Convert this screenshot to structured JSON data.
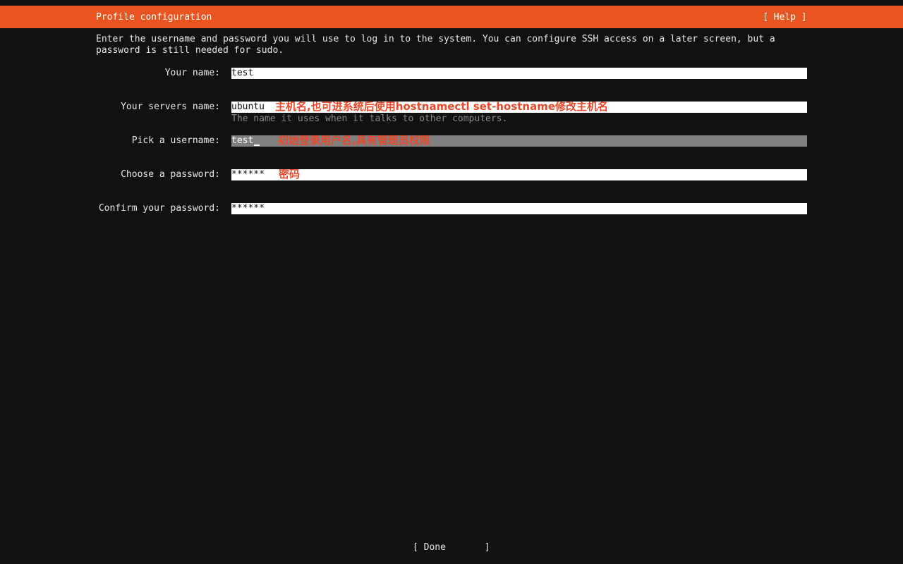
{
  "header": {
    "title": "Profile configuration",
    "help_label": "[ Help ]"
  },
  "intro": "Enter the username and password you will use to log in to the system. You can configure SSH access on a later screen, but a password is still needed for sudo.",
  "fields": {
    "your_name": {
      "label": "Your name:",
      "value": "test"
    },
    "server_name": {
      "label": "Your servers name:",
      "value": "ubuntu",
      "annotation": "主机名,也可进系统后使用hostnamectl set-hostname修改主机名",
      "hint": "The name it uses when it talks to other computers."
    },
    "username": {
      "label": "Pick a username:",
      "value": "test",
      "annotation": "初始登录用户名,具有管理员权限"
    },
    "password": {
      "label": "Choose a password:",
      "value": "******",
      "annotation": "密码"
    },
    "confirm_password": {
      "label": "Confirm your password:",
      "value": "******"
    }
  },
  "done_label": "[ Done       ]",
  "colors": {
    "accent": "#e95420",
    "annotation": "#e8492a",
    "background": "#111111",
    "focused_field": "#808080"
  }
}
